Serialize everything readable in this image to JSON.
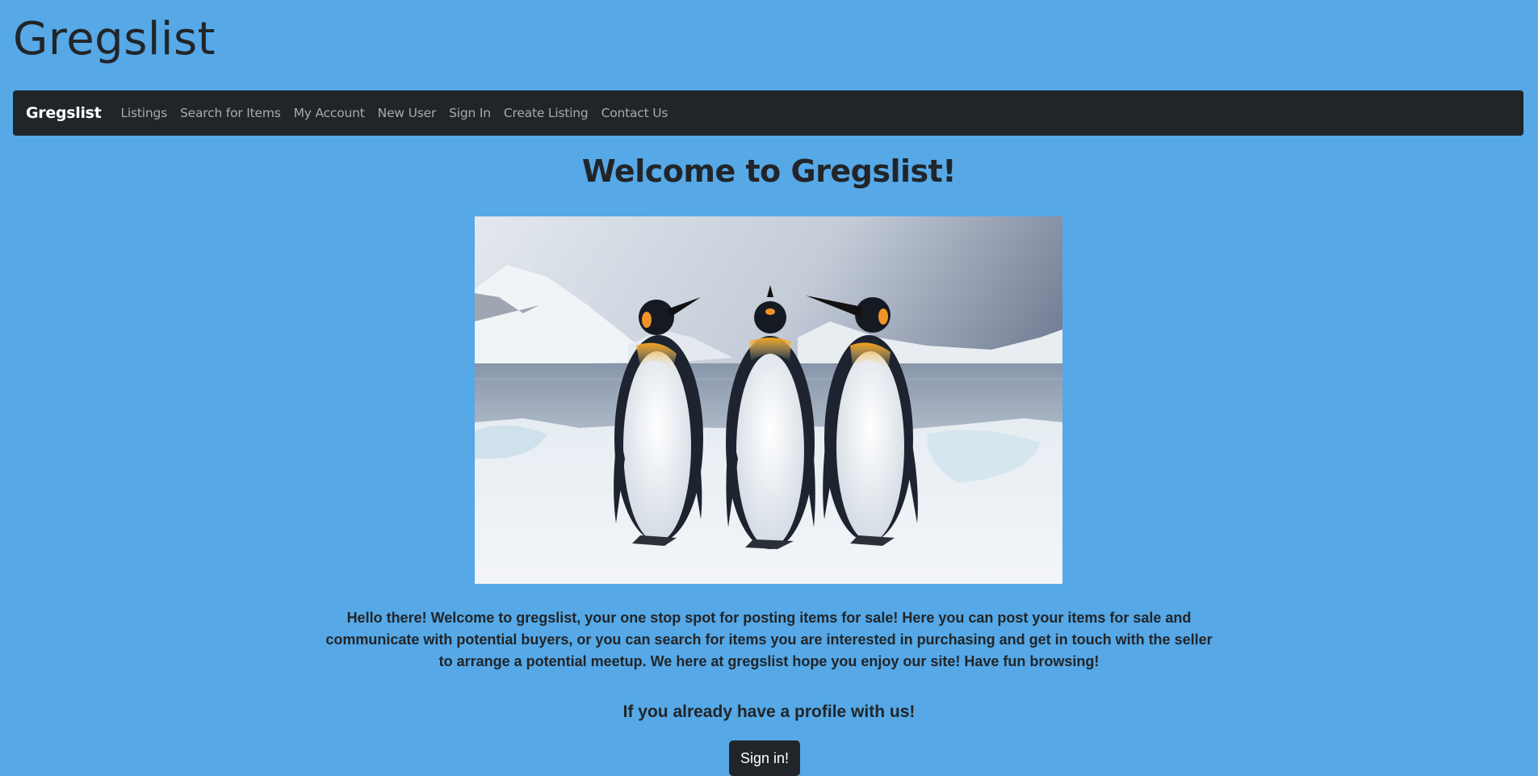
{
  "site": {
    "title": "Gregslist"
  },
  "navbar": {
    "brand": "Gregslist",
    "links": [
      {
        "label": "Listings"
      },
      {
        "label": "Search for Items"
      },
      {
        "label": "My Account"
      },
      {
        "label": "New User"
      },
      {
        "label": "Sign In"
      },
      {
        "label": "Create Listing"
      },
      {
        "label": "Contact Us"
      }
    ],
    "background_color": "#212529"
  },
  "main": {
    "heading": "Welcome to Gregslist!",
    "hero_image": "three-king-penguins-on-snow",
    "intro": "Hello there! Welcome to gregslist, your one stop spot for posting items for sale! Here you can post your items for sale and communicate with potential buyers, or you can search for items you are interested in purchasing and get in touch with the seller to arrange a potential meetup. We here at gregslist hope you enjoy our site! Have fun browsing!",
    "profile_prompt": "If you already have a profile with us!",
    "signin_button": "Sign in!"
  },
  "colors": {
    "page_background": "#56a8e6",
    "text": "#212529"
  }
}
